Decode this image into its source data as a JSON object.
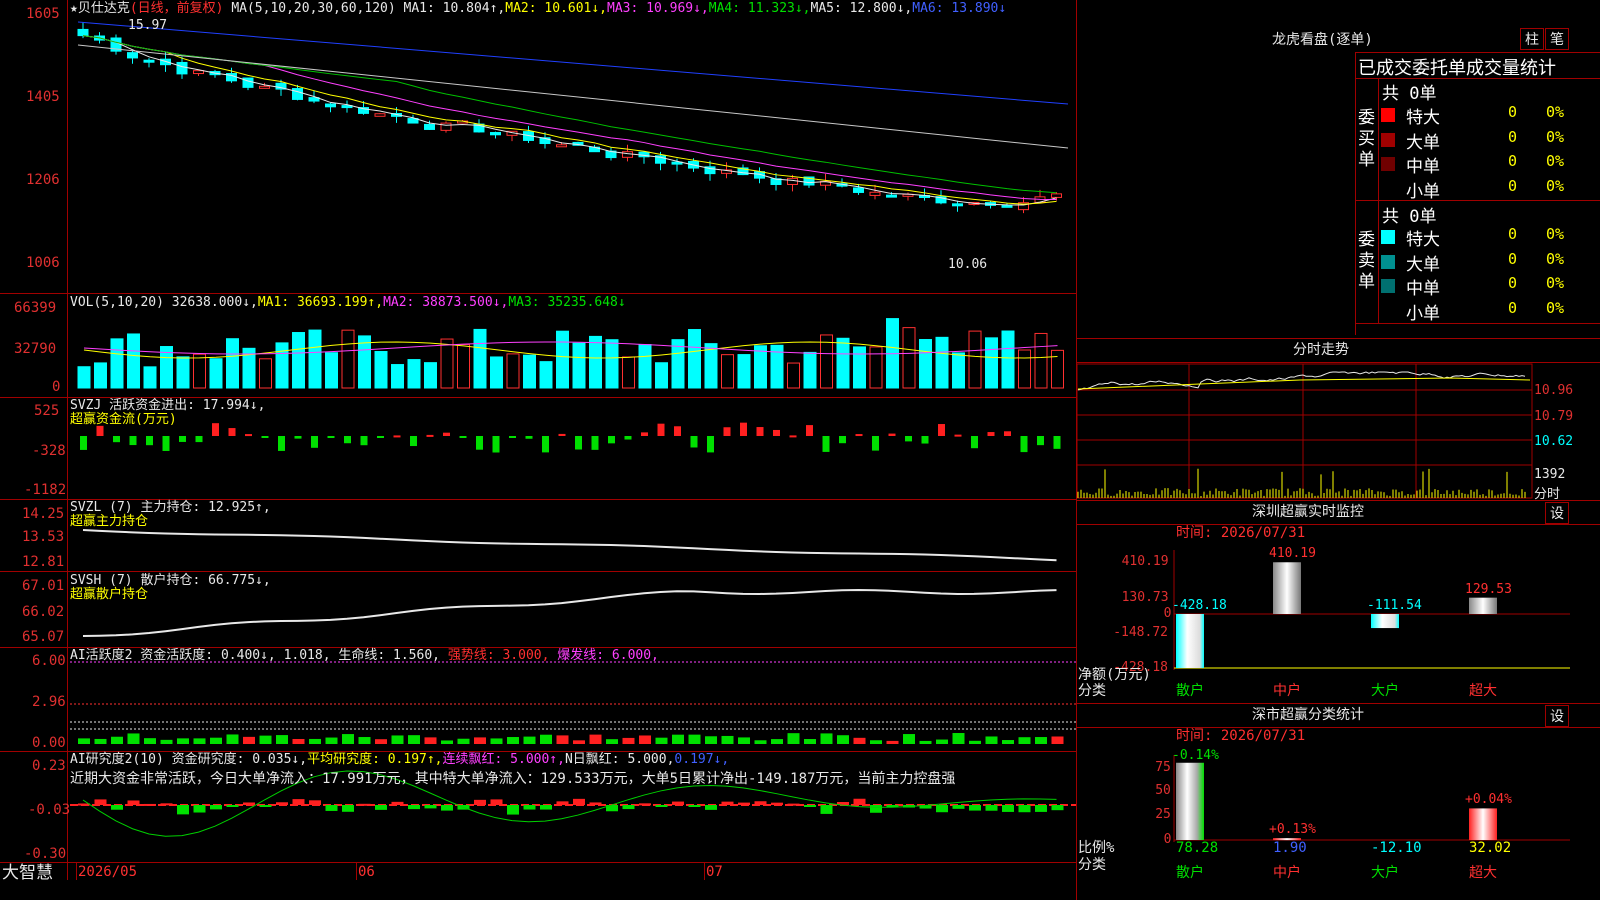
{
  "stock": {
    "title": "★贝仕达克",
    "period": "(日线，前复权)",
    "ma_prefix": "MA(5,10,20,30,60,120)",
    "ma1": "MA1: 10.804↑,",
    "ma2": "MA2: 10.601↓,",
    "ma3": "MA3: 10.969↓,",
    "ma4": "MA4: 11.323↓,",
    "ma5": "MA5: 12.800↓,",
    "ma6": "MA6: 13.890↓",
    "high_label": "15.97",
    "low_label": "10.06"
  },
  "price_axis": [
    "1605",
    "1405",
    "1206",
    "1006"
  ],
  "vol": {
    "header": "VOL(5,10,20)",
    "val": "32638.000↓,",
    "ma1": "MA1: 36693.199↑,",
    "ma2": "MA2: 38873.500↓,",
    "ma3": "MA3: 35235.648↓",
    "axis": [
      "66399",
      "32790",
      "0"
    ]
  },
  "svzj": {
    "header": "SVZJ  活跃资金进出: 17.994↓,",
    "sub": "超赢资金流(万元)",
    "axis": [
      "525",
      "-328",
      "-1182"
    ]
  },
  "svzl": {
    "header": "SVZL (7) 主力持仓: 12.925↑,",
    "sub": "超赢主力持仓",
    "axis": [
      "14.25",
      "13.53",
      "12.81"
    ]
  },
  "svsh": {
    "header": "SVSH (7) 散户持仓: 66.775↓,",
    "sub": "超赢散户持仓",
    "axis": [
      "67.01",
      "66.02",
      "65.07"
    ]
  },
  "ai": {
    "header_a": "AI活跃度2 资金活跃度: 0.400↓, 1.018, 生命线: 1.560,",
    "header_b": "强势线: 3.000,",
    "header_c": "爆发线: 6.000,",
    "axis": [
      "6.00",
      "2.96",
      "0.00"
    ]
  },
  "ai2": {
    "header_a": "AI研究度2(10) 资金研究度: 0.035↓,",
    "header_b": "平均研究度: 0.197↑,",
    "header_c": "连续飘红: 5.000↑,",
    "header_d": "N日飘红: 5.000,",
    "header_e": "0.197↓,",
    "note": "近期大资金非常活跃，今日大单净流入：17.991万元，其中特大单净流入：129.533万元，大单5日累计净出-149.187万元，当前主力控盘强",
    "axis": [
      "0.23",
      "-0.03",
      "-0.30"
    ]
  },
  "bottom": {
    "brand": "大智慧",
    "d1": "2026/05",
    "d2": "06",
    "d3": "07"
  },
  "lhb": {
    "title": "龙虎看盘(逐单)",
    "btn1": "柱",
    "btn2": "笔",
    "subtitle": "已成交委托单成交量统计",
    "buy_label": "委买单",
    "sell_label": "委卖单",
    "buy_total": "共 0单",
    "sell_total": "共 0单",
    "rows_buy": [
      {
        "name": "特大",
        "n": "0",
        "p": "0%",
        "color": "#ff0000"
      },
      {
        "name": "大单",
        "n": "0",
        "p": "0%",
        "color": "#a00000"
      },
      {
        "name": "中单",
        "n": "0",
        "p": "0%",
        "color": "#700000"
      },
      {
        "name": "小单",
        "n": "0",
        "p": "0%",
        "color": ""
      }
    ],
    "rows_sell": [
      {
        "name": "特大",
        "n": "0",
        "p": "0%",
        "color": "#00ffff"
      },
      {
        "name": "大单",
        "n": "0",
        "p": "0%",
        "color": "#009090"
      },
      {
        "name": "中单",
        "n": "0",
        "p": "0%",
        "color": "#007070"
      },
      {
        "name": "小单",
        "n": "0",
        "p": "0%",
        "color": ""
      }
    ]
  },
  "fenshi": {
    "title": "分时走势",
    "axis": [
      "10.96",
      "10.79",
      "10.62",
      "1392"
    ],
    "fs_label": "分时"
  },
  "sz_monitor": {
    "title": "深圳超赢实时监控",
    "btn": "设",
    "time": "时间: 2026/07/31",
    "axis": [
      "410.19",
      "130.73",
      "0",
      "-148.72",
      "-428.18"
    ],
    "ylabel": "净额(万元)",
    "xlabel": "分类",
    "cats": [
      "散户",
      "中户",
      "大户",
      "超大"
    ],
    "values": [
      -428.18,
      410.19,
      -111.54,
      129.53
    ],
    "value_labels": [
      "-428.18",
      "410.19",
      "-111.54",
      "129.53"
    ]
  },
  "sz_class": {
    "title": "深市超赢分类统计",
    "btn": "设",
    "time": "时间: 2026/07/31",
    "axis": [
      "75",
      "50",
      "25",
      "0"
    ],
    "ylabel": "比例%",
    "xlabel": "分类",
    "cats": [
      "散户",
      "中户",
      "大户",
      "超大"
    ],
    "values": [
      78.28,
      1.9,
      -12.1,
      32.02
    ],
    "value_labels": [
      "78.28",
      "1.90",
      "-12.10",
      "32.02"
    ],
    "top_labels": [
      "-0.14%",
      "+0.13%",
      "",
      "+0.04%"
    ]
  }
}
